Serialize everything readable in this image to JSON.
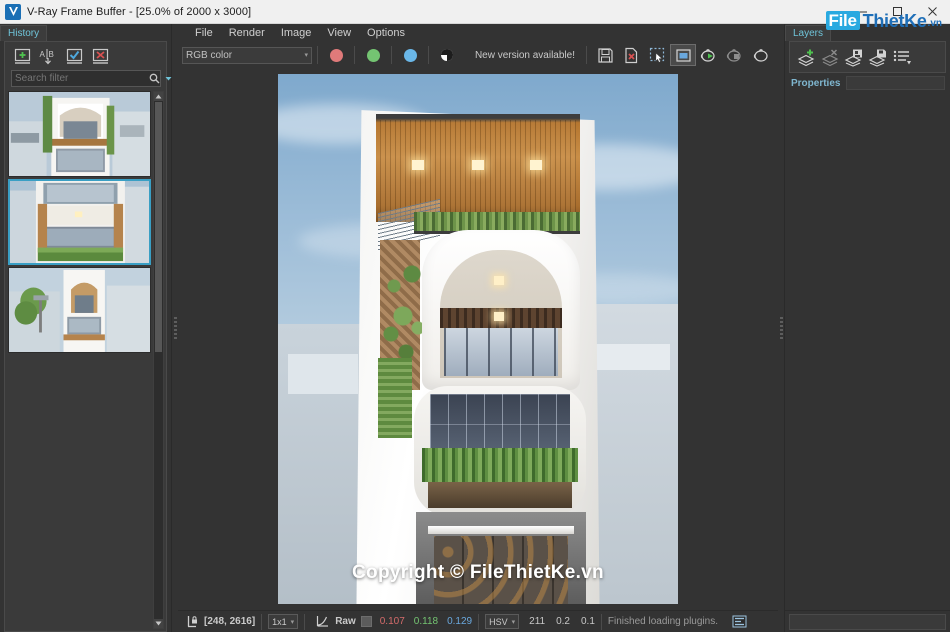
{
  "window": {
    "title": "V-Ray Frame Buffer - [25.0% of 2000 x 3000]",
    "app_icon": "vray-icon",
    "minimize": "–",
    "maximize": "□",
    "close": "✕"
  },
  "watermark": {
    "logo_file": "File",
    "logo_thiet": "ThietKe",
    "logo_vn": ".vn",
    "render_copyright": "Copyright © FileThietKe.vn"
  },
  "left_panel": {
    "tab_label": "History",
    "toolbar": [
      {
        "name": "add-to-history-button",
        "icon": "plus-box-icon"
      },
      {
        "name": "compare-ab-button",
        "icon": "ab-compare-icon"
      },
      {
        "name": "set-as-current-button",
        "icon": "check-box-icon"
      },
      {
        "name": "delete-history-button",
        "icon": "delete-box-icon"
      }
    ],
    "search": {
      "placeholder": "Search filter",
      "icon": "search-icon",
      "dropdown_icon": "chevron-down-icon"
    },
    "thumbnails": [
      {
        "label": "history-thumbnail-1",
        "selected": false
      },
      {
        "label": "history-thumbnail-2",
        "selected": true
      },
      {
        "label": "history-thumbnail-3",
        "selected": false
      }
    ]
  },
  "menubar": {
    "items": [
      {
        "label": "File"
      },
      {
        "label": "Render"
      },
      {
        "label": "Image"
      },
      {
        "label": "View"
      },
      {
        "label": "Options"
      }
    ]
  },
  "toolbar": {
    "channel_combo": {
      "value": "RGB color",
      "chevron": "▾"
    },
    "channels": [
      {
        "name": "red-channel-button",
        "color": "#e07a7a"
      },
      {
        "name": "green-channel-button",
        "color": "#74c472"
      },
      {
        "name": "blue-channel-button",
        "color": "#6ab7e8"
      },
      {
        "name": "alpha-channel-button",
        "color": "#ffffff"
      }
    ],
    "new_version": "New version available!",
    "buttons": [
      {
        "name": "save-image-button",
        "icon": "floppy-save-icon"
      },
      {
        "name": "clear-image-button",
        "icon": "file-delete-icon"
      },
      {
        "name": "region-render-button",
        "icon": "marquee-select-icon"
      },
      {
        "name": "fit-to-window-button",
        "icon": "fit-window-icon"
      },
      {
        "name": "start-render-button",
        "icon": "teapot-play-icon"
      },
      {
        "name": "stop-render-button",
        "icon": "teapot-stop-icon"
      },
      {
        "name": "render-last-button",
        "icon": "teapot-icon"
      }
    ]
  },
  "render": {
    "alt": "Architectural exterior render of a modern narrow townhouse"
  },
  "statusbar": {
    "pixel_lock_icon": "pixel-lock-icon",
    "coordinates": "[248, 2616]",
    "sample_size": {
      "value": "1x1",
      "chevron": "▾"
    },
    "curve_icon": "color-curve-icon",
    "raw_label": "Raw",
    "raw_swatch": "#5c5c5c",
    "rgb": {
      "r": "0.107",
      "g": "0.118",
      "b": "0.129"
    },
    "color_space": {
      "value": "HSV",
      "chevron": "▾"
    },
    "hsv": {
      "h": "211",
      "s": "0.2",
      "v": "0.1"
    },
    "message": "Finished loading plugins.",
    "log_icon": "log-panel-icon"
  },
  "right_panel": {
    "tab_label": "Layers",
    "toolbar": [
      {
        "name": "add-layer-button",
        "icon": "layer-add-icon"
      },
      {
        "name": "remove-layer-button",
        "icon": "layer-remove-icon"
      },
      {
        "name": "load-layers-button",
        "icon": "layer-load-icon"
      },
      {
        "name": "save-layers-button",
        "icon": "layer-save-icon"
      },
      {
        "name": "layer-presets-button",
        "icon": "layer-list-icon"
      }
    ],
    "properties_label": "Properties"
  }
}
